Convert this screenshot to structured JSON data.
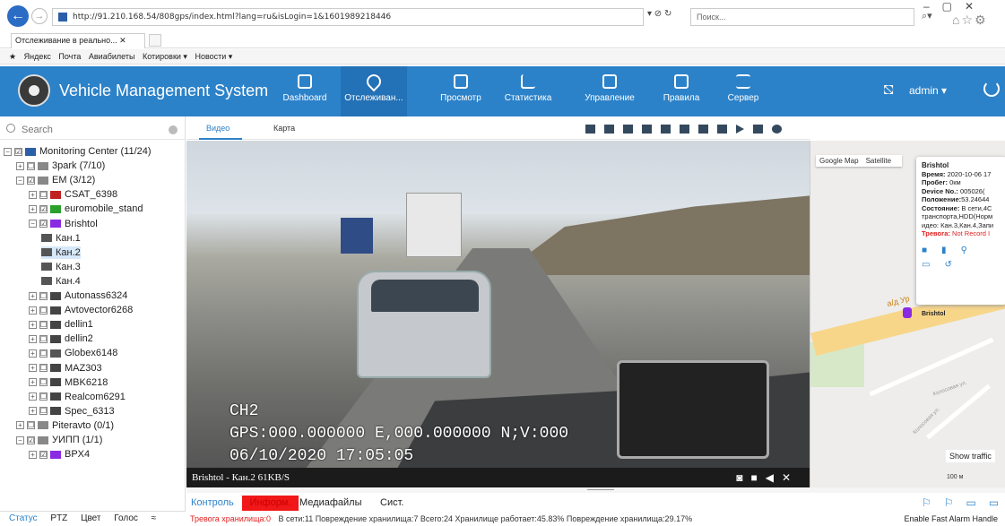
{
  "browser": {
    "address": "http://91.210.168.54/808gps/index.html?lang=ru&isLogin=1&1601989218446",
    "search_placeholder": "Поиск...",
    "tab_title": "Отслеживание в реально...",
    "favorites": [
      "Яндекс",
      "Почта",
      "Авиабилеты",
      "Котировки ▾",
      "Новости ▾"
    ]
  },
  "header": {
    "title": "Vehicle Management System",
    "nav": [
      {
        "label": "Dashboard"
      },
      {
        "label": "Отслеживан..."
      },
      {
        "label": "Просмотр"
      },
      {
        "label": "Статистика"
      },
      {
        "label": "Управление"
      },
      {
        "label": "Правила"
      },
      {
        "label": "Сервер"
      }
    ],
    "active_nav": 1,
    "user": "admin ▾"
  },
  "sidebar": {
    "search_placeholder": "Search",
    "tree": [
      {
        "level": 0,
        "toggle": "−",
        "check": "☑",
        "label": "Monitoring Center (11/24)"
      },
      {
        "level": 1,
        "toggle": "+",
        "check": "☐",
        "label": "3park (7/10)"
      },
      {
        "level": 1,
        "toggle": "−",
        "check": "☑",
        "label": "EM (3/12)"
      },
      {
        "level": 2,
        "toggle": "+",
        "check": "☐",
        "label": "CSAT_6398"
      },
      {
        "level": 2,
        "toggle": "+",
        "check": "☑",
        "label": "euromobile_stand"
      },
      {
        "level": 2,
        "toggle": "−",
        "check": "☑",
        "label": "Brishtol"
      },
      {
        "level": 3,
        "toggle": "",
        "check": "",
        "label": "Кан.1"
      },
      {
        "level": 3,
        "toggle": "",
        "check": "",
        "label": "Кан.2"
      },
      {
        "level": 3,
        "toggle": "",
        "check": "",
        "label": "Кан.3"
      },
      {
        "level": 3,
        "toggle": "",
        "check": "",
        "label": "Кан.4"
      },
      {
        "level": 2,
        "toggle": "+",
        "check": "☐",
        "label": "Autonass6324"
      },
      {
        "level": 2,
        "toggle": "+",
        "check": "☐",
        "label": "Avtovector6268"
      },
      {
        "level": 2,
        "toggle": "+",
        "check": "☐",
        "label": "dellin1"
      },
      {
        "level": 2,
        "toggle": "+",
        "check": "☐",
        "label": "dellin2"
      },
      {
        "level": 2,
        "toggle": "+",
        "check": "☐",
        "label": "Globex6148"
      },
      {
        "level": 2,
        "toggle": "+",
        "check": "☐",
        "label": "MAZ303"
      },
      {
        "level": 2,
        "toggle": "+",
        "check": "☐",
        "label": "MBK6218"
      },
      {
        "level": 2,
        "toggle": "+",
        "check": "☐",
        "label": "Realcom6291"
      },
      {
        "level": 2,
        "toggle": "+",
        "check": "☐",
        "label": "Spec_6313"
      },
      {
        "level": 1,
        "toggle": "+",
        "check": "☐",
        "label": "Piteravto (0/1)"
      },
      {
        "level": 1,
        "toggle": "−",
        "check": "☑",
        "label": "УИПП (1/1)"
      },
      {
        "level": 2,
        "toggle": "+",
        "check": "☑",
        "label": "BPX4"
      }
    ],
    "selected_index": 7,
    "status_tabs": [
      "Статус",
      "PTZ",
      "Цвет",
      "Голос",
      "≈"
    ]
  },
  "center": {
    "tabs": [
      "Видео",
      "Карта"
    ],
    "osd": {
      "channel": "CH2",
      "gps": "GPS:000.000000 E,000.000000 N;V:000",
      "datetime": "06/10/2020 17:05:05"
    },
    "video_caption": "Brishtol - Кан.2 61KB/S"
  },
  "bottom": {
    "tabs": [
      "Контроль",
      "Информ.",
      "Медиафайлы",
      "Сист."
    ],
    "status_alarm": "Тревога хранилища:0",
    "status_rest": "В сети:11   Повреждение хранилища:7   Всего:24   Хранилище работает:45.83%   Повреждение хранилища:29.17%",
    "fast_alarm": "Enable Fast Alarm Handle"
  },
  "map": {
    "tabs": [
      "Google Map",
      "Satellite"
    ],
    "road_label": "a/д Ур",
    "street1": "Колосовая ул.",
    "street2": "Колосовая ул.",
    "marker_label": "Brishtol",
    "popup": {
      "title": "Brishtol",
      "lines": [
        {
          "k": "Время:",
          "v": " 2020-10-06 17"
        },
        {
          "k": "Пробег:",
          "v": " 0км"
        },
        {
          "k": "Device No.:",
          "v": " 005026("
        },
        {
          "k": "Положение:",
          "v": "53.24644"
        },
        {
          "k": "Состояние:",
          "v": " В сети,4C"
        },
        {
          "k": "",
          "v": "транспорта,HDD(Норм"
        },
        {
          "k": "",
          "v": "идео: Кан.3,Кан.4,Запи"
        }
      ],
      "alarm_key": "Тревога:",
      "alarm_val": " Not Record I"
    },
    "show_traffic": "Show traffic",
    "scale": "100 м"
  },
  "colors": {
    "header_bg": "#2c82c9",
    "active_nav": "#2371b6",
    "alarm": "#e02020",
    "inform_tab": "#f01818"
  }
}
